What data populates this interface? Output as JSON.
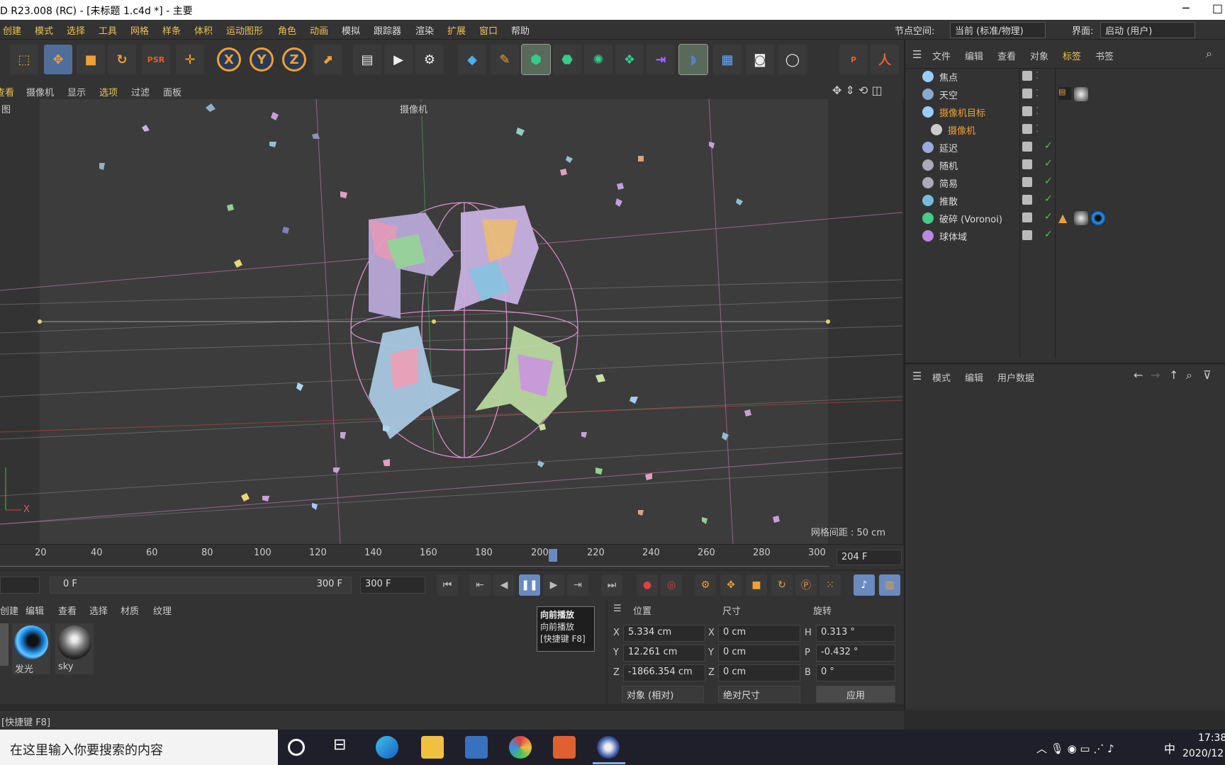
{
  "title": "D R23.008 (RC) - [未标题 1.c4d *] - 主要",
  "window_controls": [
    "─",
    "□"
  ],
  "menu": [
    "创建",
    "模式",
    "选择",
    "工具",
    "网格",
    "样条",
    "体积",
    "运动图形",
    "角色",
    "动画",
    "模拟",
    "跟踪器",
    "渲染",
    "扩展",
    "窗口",
    "帮助"
  ],
  "node_space_label": "节点空间:",
  "node_space_value": "当前 (标准/物理)",
  "interface_label": "界面:",
  "interface_value": "启动 (用户)",
  "toolbar": {
    "x": "X",
    "y": "Y",
    "z": "Z",
    "psr": "PSR"
  },
  "viewport_menu": [
    "查看",
    "摄像机",
    "显示",
    "选项",
    "过滤",
    "面板"
  ],
  "viewport": {
    "corner_label": "图",
    "camera_label": "摄像机",
    "grid_spacing": "网格间距 : 50 cm",
    "axis_x": "X"
  },
  "timeline": {
    "ticks": [
      "20",
      "40",
      "60",
      "80",
      "100",
      "120",
      "140",
      "160",
      "180",
      "200",
      "220",
      "240",
      "260",
      "280",
      "300"
    ],
    "current_frame": "204 F"
  },
  "transport": {
    "start": "0 F",
    "end": "300 F",
    "end2": "300 F"
  },
  "material_menu": [
    "创建",
    "编辑",
    "查看",
    "选择",
    "材质",
    "纹理"
  ],
  "materials": [
    {
      "name": "发光"
    },
    {
      "name": "sky"
    }
  ],
  "tooltip": {
    "title": "向前播放",
    "desc": "向前播放",
    "shortcut": "[快捷键 F8]"
  },
  "coords": {
    "headers": [
      "位置",
      "尺寸",
      "旋转"
    ],
    "rows": [
      {
        "axis": "X",
        "pos": "5.334 cm",
        "size_axis": "X",
        "size": "0 cm",
        "rot_axis": "H",
        "rot": "0.313 °"
      },
      {
        "axis": "Y",
        "pos": "12.261 cm",
        "size_axis": "Y",
        "size": "0 cm",
        "rot_axis": "P",
        "rot": "-0.432 °"
      },
      {
        "axis": "Z",
        "pos": "-1866.354 cm",
        "size_axis": "Z",
        "size": "0 cm",
        "rot_axis": "B",
        "rot": "0 °"
      }
    ],
    "mode_select": "对象 (相对)",
    "size_select": "绝对尺寸",
    "apply": "应用"
  },
  "status": "[快捷键 F8]",
  "object_manager": {
    "menu": [
      "文件",
      "编辑",
      "查看",
      "对象",
      "标签",
      "书签"
    ],
    "objects": [
      {
        "name": "焦点",
        "color": "#9cf"
      },
      {
        "name": "天空",
        "color": "#8ac"
      },
      {
        "name": "摄像机目标",
        "color": "#9cf"
      },
      {
        "name": "摄像机",
        "color": "#ccc"
      },
      {
        "name": "延迟",
        "color": "#9ad"
      },
      {
        "name": "随机",
        "color": "#aab"
      },
      {
        "name": "简易",
        "color": "#aab"
      },
      {
        "name": "推散",
        "color": "#7bd"
      },
      {
        "name": "破碎 (Voronoi)",
        "color": "#4c8"
      },
      {
        "name": "球体域",
        "color": "#b8d"
      }
    ]
  },
  "attribute_manager": {
    "menu": [
      "模式",
      "编辑",
      "用户数据"
    ]
  },
  "taskbar": {
    "search_placeholder": "在这里输入你要搜索的内容",
    "time": "17:38",
    "date": "2020/12",
    "ime": "中"
  },
  "colors": {
    "accent": "#f0a030",
    "bg": "#333333",
    "viewport": "#3c3c3c"
  }
}
